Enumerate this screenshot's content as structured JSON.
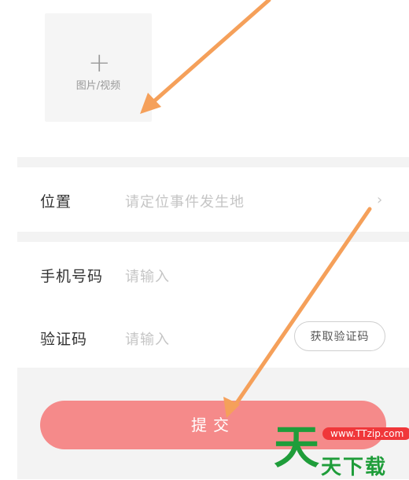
{
  "upload": {
    "plus": "+",
    "label": "图片/视频"
  },
  "location": {
    "label": "位置",
    "placeholder": "请定位事件发生地",
    "chevron": "›"
  },
  "phone": {
    "label": "手机号码",
    "placeholder": "请输入"
  },
  "code": {
    "label": "验证码",
    "placeholder": "请输入",
    "button": "获取验证码"
  },
  "submit": {
    "label": "提交"
  },
  "watermark": {
    "logo": "天",
    "url": "www.TTzip.com",
    "text": "天下载"
  },
  "colors": {
    "accent": "#f58a8a",
    "arrow": "#f5a05a",
    "watermark_green": "#1f9d3a",
    "watermark_red": "#f0373a"
  }
}
